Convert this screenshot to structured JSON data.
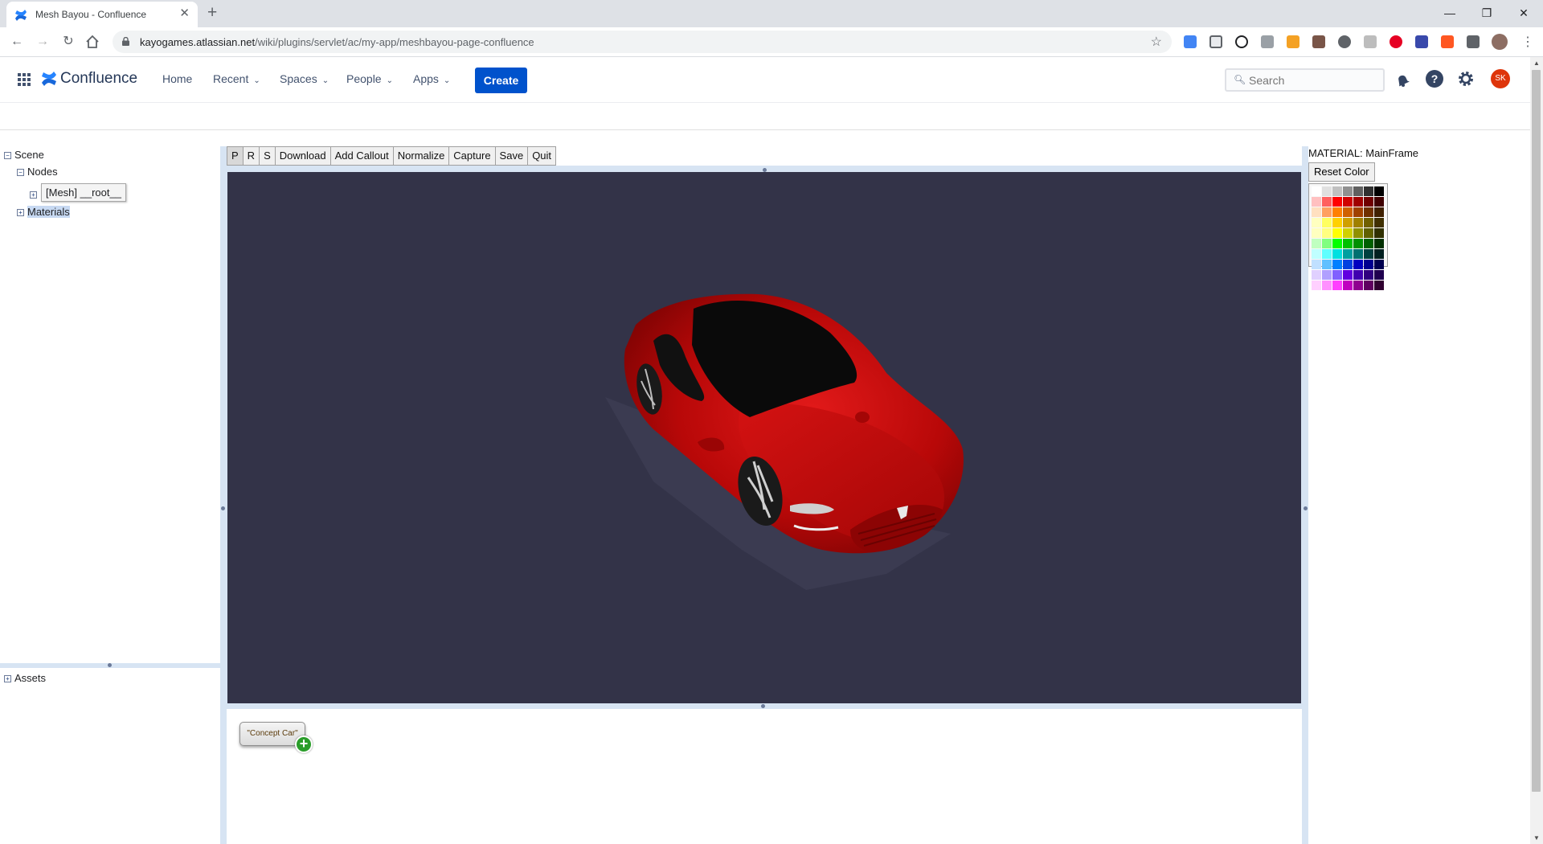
{
  "browser": {
    "tab_title": "Mesh Bayou - Confluence",
    "url_host": "kayogames.atlassian.net",
    "url_path": "/wiki/plugins/servlet/ac/my-app/meshbayou-page-confluence"
  },
  "confluence": {
    "brand": "Confluence",
    "nav": {
      "home": "Home",
      "recent": "Recent",
      "spaces": "Spaces",
      "people": "People",
      "apps": "Apps"
    },
    "create_label": "Create",
    "search_placeholder": "Search",
    "user_initials": "SK"
  },
  "tree": {
    "scene": "Scene",
    "nodes": "Nodes",
    "mesh_node": "[Mesh] __root__",
    "materials": "Materials",
    "assets": "Assets"
  },
  "toolbar": {
    "p": "P",
    "r": "R",
    "s": "S",
    "download": "Download",
    "add_callout": "Add Callout",
    "normalize": "Normalize",
    "capture": "Capture",
    "save": "Save",
    "quit": "Quit"
  },
  "callout": {
    "label": "\"Concept Car\""
  },
  "material": {
    "title": "MATERIAL: MainFrame",
    "reset_label": "Reset Color",
    "palette": [
      "#ffffff",
      "#e0e0e0",
      "#c0c0c0",
      "#909090",
      "#606060",
      "#303030",
      "#000000",
      "#ffc0c0",
      "#ff6060",
      "#ff0000",
      "#d00000",
      "#a00000",
      "#700000",
      "#400000",
      "#ffe0c0",
      "#ffa060",
      "#ff8000",
      "#d06000",
      "#a04000",
      "#703000",
      "#402000",
      "#ffffc0",
      "#ffff60",
      "#ffd000",
      "#d0a000",
      "#a08000",
      "#706000",
      "#403000",
      "#ffffc0",
      "#ffff80",
      "#ffff00",
      "#d0d000",
      "#909000",
      "#606000",
      "#303000",
      "#c0ffc0",
      "#80ff80",
      "#00ff00",
      "#00c000",
      "#009000",
      "#006000",
      "#003000",
      "#c0ffff",
      "#60ffff",
      "#00e0e0",
      "#00a0a0",
      "#007070",
      "#004040",
      "#002020",
      "#c0e0ff",
      "#60c0ff",
      "#0080ff",
      "#0040e0",
      "#0000c0",
      "#000090",
      "#000050",
      "#e0d0ff",
      "#b0a0ff",
      "#8060ff",
      "#6000e0",
      "#4000b0",
      "#300080",
      "#200050",
      "#ffd0ff",
      "#ff90ff",
      "#ff40ff",
      "#c000c0",
      "#900090",
      "#600060",
      "#300030"
    ]
  },
  "colors": {
    "brand_blue": "#0052cc",
    "viewport_bg": "#333348",
    "car_red": "#c00c0c",
    "avatar_red": "#de350b"
  }
}
